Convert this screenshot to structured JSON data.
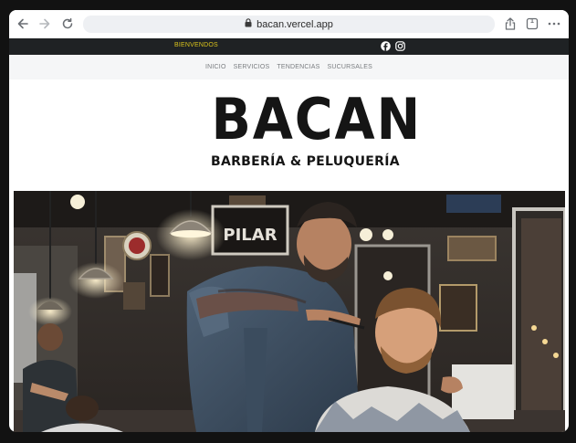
{
  "browser": {
    "url": "bacan.vercel.app",
    "tab_count": "1",
    "icons": [
      "back-icon",
      "forward-icon",
      "reload-icon",
      "lock-icon",
      "share-icon",
      "tabs-icon",
      "more-icon"
    ]
  },
  "topbar": {
    "welcome": "BIENVENDOS",
    "accent": "#d9c21c",
    "background": "#1f2224",
    "social_icons": [
      "facebook-icon",
      "instagram-icon"
    ]
  },
  "nav": {
    "items": [
      {
        "label": "INICIO"
      },
      {
        "label": "SERVICIOS"
      },
      {
        "label": "TENDENCIAS"
      },
      {
        "label": "SUCURSALES"
      }
    ]
  },
  "brand": {
    "name": "BACAN",
    "tagline": "BARBERÍA & PELUQUERÍA"
  },
  "hero": {
    "sign_text": "PILAR"
  }
}
